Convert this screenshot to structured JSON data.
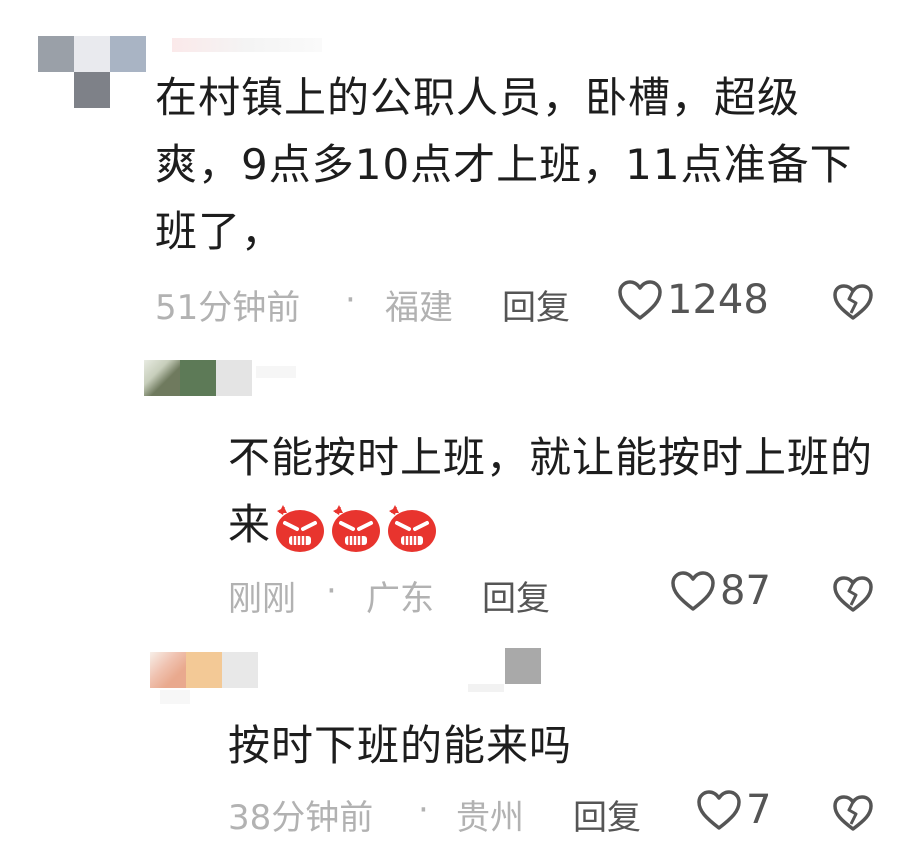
{
  "comments": [
    {
      "text": "在村镇上的公职人员，卧槽，超级爽，9点多10点才上班，11点准备下班了，",
      "lines": [
        "在村镇上的公职人员，卧槽，超级",
        "爽，9点多10点才上班，11点准备下",
        "班了，"
      ],
      "time": "51分钟前",
      "separator": "·",
      "location": "福建",
      "reply_label": "回复",
      "likes": "1248",
      "avatar_colors": [
        "#9aa0a8",
        "#e9eaee",
        "#a9b4c4",
        "#7e8188"
      ]
    },
    {
      "lines": [
        "不能按时上班，就让能按时上班的",
        "来"
      ],
      "emoji_icons": [
        "angry-face-icon",
        "angry-face-icon",
        "angry-face-icon"
      ],
      "time": "刚刚",
      "separator": "·",
      "location": "广东",
      "reply_label": "回复",
      "likes": "87",
      "avatar_colors": [
        "#6f7a5e",
        "#5d7a57",
        "#e4e4e4"
      ]
    },
    {
      "lines": [
        "按时下班的能来吗"
      ],
      "time": "38分钟前",
      "separator": "·",
      "location": "贵州",
      "reply_label": "回复",
      "likes": "7",
      "avatar_colors": [
        "#e9a98e",
        "#f3c996",
        "#e8e8e8",
        "#a9a9a9"
      ]
    }
  ],
  "colors": {
    "text": "#1d1d1d",
    "meta": "#b2b2b2",
    "icon": "#555555",
    "emoji_red": "#e8342e"
  }
}
